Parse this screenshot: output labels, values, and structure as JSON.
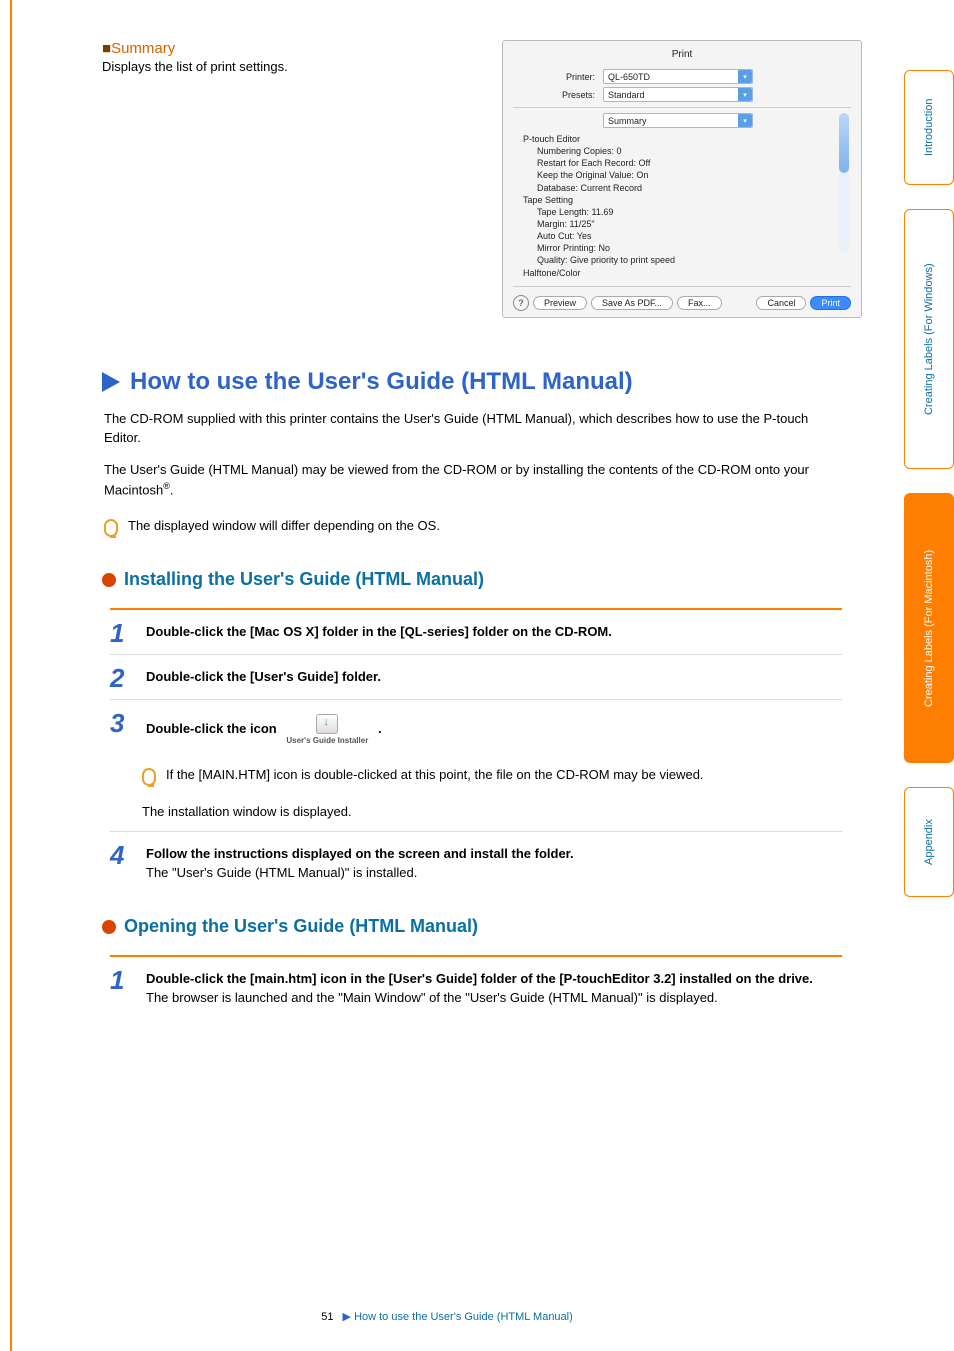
{
  "summary": {
    "heading": "Summary",
    "desc": "Displays the list of print settings."
  },
  "print_dialog": {
    "title": "Print",
    "rows": {
      "printer_label": "Printer:",
      "printer_value": "QL-650TD",
      "presets_label": "Presets:",
      "presets_value": "Standard",
      "panel_value": "Summary"
    },
    "details": {
      "ptouch": "P-touch Editor",
      "lines": [
        "Numbering Copies:  0",
        "Restart for Each Record:  Off",
        "Keep the Original Value:  On",
        "Database:  Current Record"
      ],
      "tape": "Tape Setting",
      "tape_lines": [
        "Tape Length:  11.69",
        "Margin:  11/25\"",
        "Auto Cut:  Yes",
        "Mirror Printing:  No",
        "Quality:  Give priority to print speed"
      ],
      "halftone": "Halftone/Color"
    },
    "buttons": {
      "help": "?",
      "preview": "Preview",
      "save_pdf": "Save As PDF...",
      "fax": "Fax...",
      "cancel": "Cancel",
      "print": "Print"
    }
  },
  "main_section": {
    "title": "How to use the User's Guide (HTML Manual)",
    "para1": "The CD-ROM supplied with this printer contains the User's Guide (HTML Manual), which describes how to use the P-touch Editor.",
    "para2a": "The User's Guide (HTML Manual) may be viewed from the CD-ROM or by installing the contents of the CD-ROM onto your Macintosh",
    "para2b": ".",
    "tip": "The  displayed window will differ depending on the OS."
  },
  "install": {
    "title": "Installing the User's Guide (HTML Manual)",
    "steps": {
      "s1": "Double-click the [Mac OS X] folder in the [QL-series] folder on the CD-ROM.",
      "s2": "Double-click the [User's Guide] folder.",
      "s3a": "Double-click the icon",
      "s3b": ".",
      "installer_label": "User's Guide Installer",
      "s3_tip": "If the [MAIN.HTM] icon is double-clicked at this point, the file on the CD-ROM may be viewed.",
      "s3_after": "The installation window is displayed.",
      "s4": "Follow the instructions displayed on the screen and install the folder.",
      "s4_after": "The \"User's Guide (HTML Manual)\" is installed."
    }
  },
  "open": {
    "title": "Opening the User's Guide (HTML Manual)",
    "s1": "Double-click the [main.htm] icon in the [User's Guide] folder of the [P-touchEditor 3.2] installed on the drive.",
    "s1_after": "The browser is launched and the \"Main Window\" of the \"User's Guide (HTML Manual)\" is displayed."
  },
  "footer": {
    "page": "51",
    "crumb": "How to use the User's Guide (HTML Manual)"
  },
  "tabs": {
    "intro": "Introduction",
    "win": "Creating Labels (For Windows)",
    "mac": "Creating Labels (For Macintosh)",
    "appx": "Appendix"
  }
}
